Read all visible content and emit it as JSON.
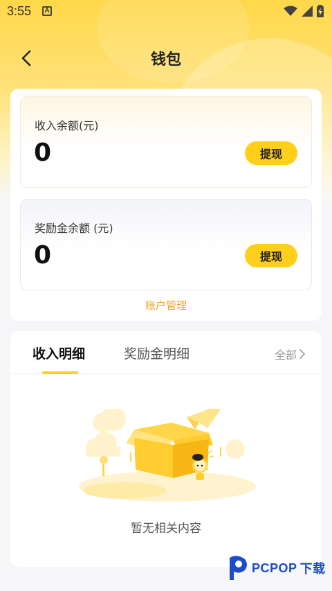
{
  "status_bar": {
    "time": "3:55",
    "notification_icon": "A"
  },
  "header": {
    "title": "钱包"
  },
  "income_balance": {
    "label": "收入余额(元)",
    "amount": "0",
    "withdraw_label": "提现"
  },
  "bonus_balance": {
    "label": "奖励金余额 (元)",
    "amount": "0",
    "withdraw_label": "提现"
  },
  "account_management_label": "账户管理",
  "tabs": [
    {
      "label": "收入明细",
      "active": true
    },
    {
      "label": "奖励金明细",
      "active": false
    }
  ],
  "all_label": "全部",
  "empty_message": "暂无相关内容",
  "watermark": {
    "brand": "PCPOP",
    "suffix": "下载"
  },
  "colors": {
    "accent": "#ffcf1c",
    "link": "#f0a028",
    "header_bg": "#ffd84a"
  }
}
